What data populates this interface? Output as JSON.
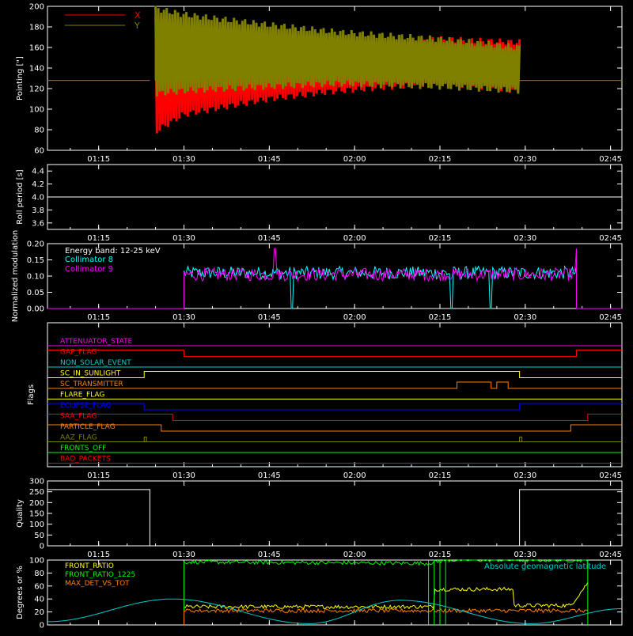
{
  "colors": {
    "background": "#000000",
    "axis": "#ffffff",
    "x_series": "#ff0000",
    "y_series": "#808000",
    "roll_line": "#ffffff",
    "collimator_8": "#00ffff",
    "collimator_9": "#ff00ff",
    "quality_line": "#ffffff",
    "front_ratio": "#ffff00",
    "front_ratio_1225": "#00ff00",
    "max_det_vs_tot": "#ff8000",
    "geomag": "#00cccc"
  },
  "time_ticks": [
    "01:15",
    "01:30",
    "01:45",
    "02:00",
    "02:15",
    "02:30",
    "02:45"
  ],
  "chart_data": [
    {
      "type": "line",
      "ylabel": "Pointing [\"]",
      "ylim": [
        60,
        200
      ],
      "yticks": [
        "60",
        "80",
        "100",
        "120",
        "140",
        "160",
        "180",
        "200"
      ],
      "xlim": [
        "01:06",
        "02:47"
      ],
      "legend_position": "top-left",
      "series": [
        {
          "name": "X",
          "x": [
            "01:06",
            "01:24",
            "01:25",
            "01:30",
            "01:45",
            "01:57",
            "02:15",
            "02:29",
            "02:47"
          ],
          "upper": [
            128,
            128,
            190,
            182,
            172,
            165,
            168,
            165,
            128
          ],
          "lower": [
            128,
            128,
            78,
            95,
            110,
            118,
            125,
            118,
            128
          ]
        },
        {
          "name": "Y",
          "x": [
            "01:06",
            "01:24",
            "01:25",
            "01:30",
            "01:45",
            "01:57",
            "02:15",
            "02:29",
            "02:47"
          ],
          "upper": [
            128,
            128,
            198,
            192,
            182,
            175,
            168,
            160,
            128
          ],
          "lower": [
            128,
            128,
            115,
            118,
            122,
            125,
            122,
            118,
            128
          ]
        }
      ]
    },
    {
      "type": "line",
      "ylabel": "Roll period [s]",
      "ylim": [
        3.5,
        4.5
      ],
      "yticks": [
        "3.6",
        "3.8",
        "4.0",
        "4.2",
        "4.4"
      ],
      "series": [
        {
          "x": [
            "01:06",
            "02:47"
          ],
          "values": [
            4.0,
            4.0
          ]
        }
      ]
    },
    {
      "type": "line",
      "ylabel": "Normalized modulation",
      "ylim": [
        0,
        0.2
      ],
      "yticks": [
        "0.00",
        "0.05",
        "0.10",
        "0.15",
        "0.20"
      ],
      "annotation": "Energy band: 12-25 keV",
      "series": [
        {
          "name": "Collimator 8",
          "x_start": "01:30",
          "x_end": "02:39",
          "mean": 0.11,
          "spread": 0.02,
          "dropouts": [
            "01:49",
            "02:17",
            "02:24"
          ]
        },
        {
          "name": "Collimator 9",
          "x_start": "01:30",
          "x_end": "02:39",
          "mean": 0.105,
          "spread": 0.02,
          "spikes": [
            "01:46",
            "02:39"
          ]
        }
      ]
    },
    {
      "type": "table",
      "ylabel": "Flags",
      "flags": [
        {
          "name": "ATTENUATOR_STATE",
          "color": "#ff00ff",
          "segments": []
        },
        {
          "name": "GAP_FLAG",
          "color": "#ff0000",
          "segments": [
            [
              "01:06",
              "01:30",
              1
            ],
            [
              "01:30",
              "02:39",
              0
            ],
            [
              "02:39",
              "02:47",
              1
            ]
          ]
        },
        {
          "name": "NON_SOLAR_EVENT",
          "color": "#00cccc",
          "segments": []
        },
        {
          "name": "SC_IN_SUNLIGHT",
          "color": "#ffff00",
          "segments": [
            [
              "01:06",
              "01:23",
              0
            ],
            [
              "01:23",
              "02:29",
              1
            ],
            [
              "02:29",
              "02:47",
              0
            ]
          ]
        },
        {
          "name": "SC_TRANSMITTER",
          "color": "#ff8000",
          "segments": [
            [
              "01:06",
              "02:18",
              0
            ],
            [
              "02:18",
              "02:24",
              1
            ],
            [
              "02:24",
              "02:25",
              0
            ],
            [
              "02:25",
              "02:27",
              1
            ],
            [
              "02:27",
              "02:47",
              0
            ]
          ]
        },
        {
          "name": "FLARE_FLAG",
          "color": "#ffff00",
          "segments": []
        },
        {
          "name": "ECLIPSE_FLAG",
          "color": "#0000ff",
          "segments": [
            [
              "01:06",
              "01:23",
              1
            ],
            [
              "01:23",
              "02:29",
              0
            ],
            [
              "02:29",
              "02:47",
              1
            ]
          ]
        },
        {
          "name": "SAA_FLAG",
          "color": "#ff0000",
          "segments": [
            [
              "01:06",
              "01:28",
              1
            ],
            [
              "01:28",
              "02:41",
              0
            ],
            [
              "02:41",
              "02:47",
              1
            ]
          ]
        },
        {
          "name": "PARTICLE_FLAG",
          "color": "#ff8000",
          "segments": [
            [
              "01:06",
              "01:26",
              1
            ],
            [
              "01:26",
              "02:38",
              0
            ],
            [
              "02:38",
              "02:47",
              1
            ]
          ]
        },
        {
          "name": "AAZ_FLAG",
          "color": "#808000",
          "pulses": [
            "01:23",
            "02:29"
          ]
        },
        {
          "name": "FRONTS_OFF",
          "color": "#00ff00",
          "segments": []
        },
        {
          "name": "BAD_PACKETS",
          "color": "#ff0000",
          "segments": []
        }
      ]
    },
    {
      "type": "line",
      "ylabel": "Quality",
      "ylim": [
        0,
        300
      ],
      "yticks": [
        "0",
        "50",
        "100",
        "150",
        "200",
        "250",
        "300"
      ],
      "series": [
        {
          "x": [
            "01:06",
            "01:24",
            "01:24",
            "02:29",
            "02:29",
            "02:47"
          ],
          "values": [
            260,
            260,
            0,
            0,
            260,
            260
          ]
        }
      ]
    },
    {
      "type": "line",
      "ylabel": "Degrees or %",
      "ylim": [
        0,
        100
      ],
      "yticks": [
        "0",
        "20",
        "40",
        "60",
        "80",
        "100"
      ],
      "annotation": "Absolute geomagnetic latitude",
      "series": [
        {
          "name": "FRONT_RATIO",
          "x": [
            "01:30",
            "02:14",
            "02:14",
            "02:28",
            "02:28",
            "02:38",
            "02:41"
          ],
          "values": [
            28,
            28,
            55,
            55,
            30,
            30,
            65
          ]
        },
        {
          "name": "FRONT_RATIO_1225",
          "x": [
            "01:30",
            "02:13",
            "02:16",
            "02:41"
          ],
          "values": [
            97,
            95,
            100,
            100
          ]
        },
        {
          "name": "MAX_DET_VS_TOT",
          "x": [
            "01:30",
            "02:41"
          ],
          "values": [
            22,
            22
          ]
        },
        {
          "name": "geomagnetic_latitude",
          "x": [
            "01:06",
            "01:28",
            "01:52",
            "02:08",
            "02:31",
            "02:47"
          ],
          "values": [
            5,
            40,
            2,
            38,
            2,
            25
          ]
        }
      ]
    }
  ]
}
